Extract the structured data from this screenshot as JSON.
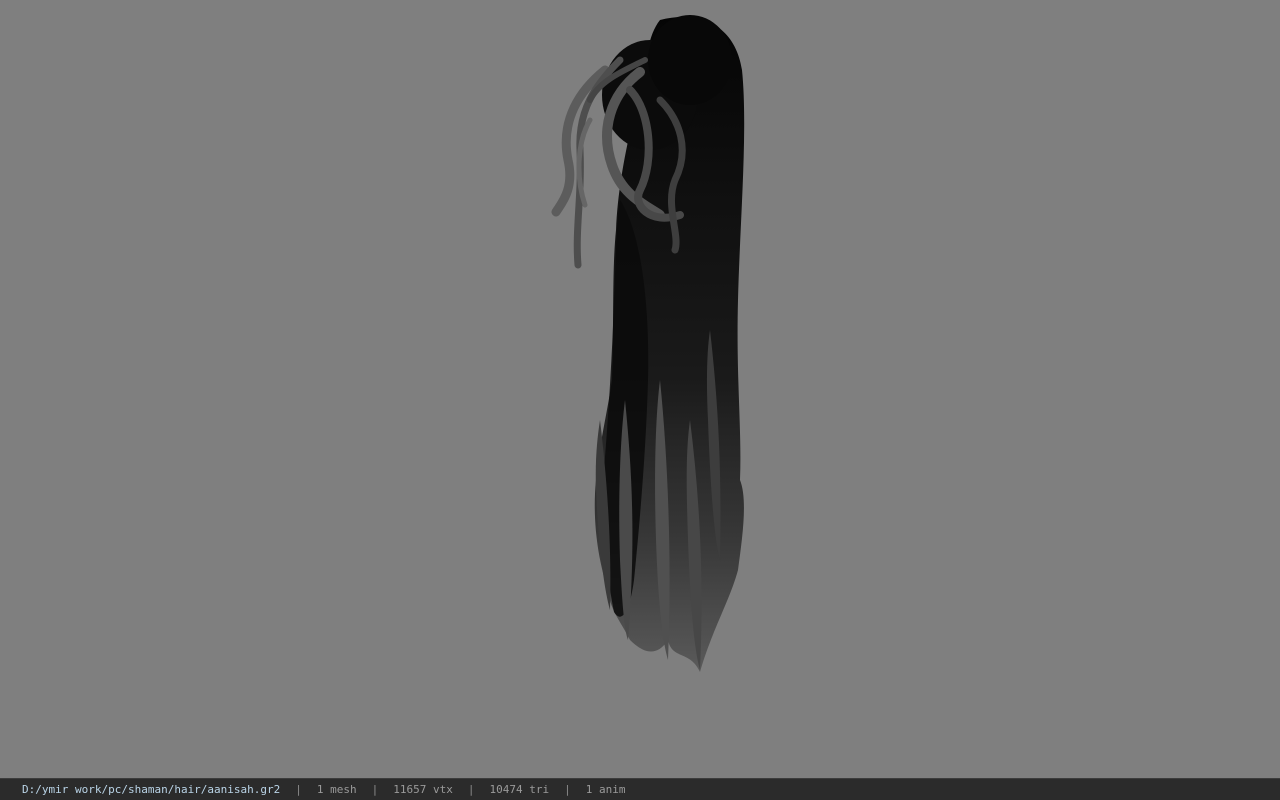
{
  "viewport": {
    "background": "#7f7f7f",
    "model_icon": "hair-model"
  },
  "status": {
    "file_path": "D:/ymir work/pc/shaman/hair/aanisah.gr2",
    "separator": "|",
    "mesh_count": "1 mesh",
    "vertex_count": "11657 vtx",
    "triangle_count": "10474 tri",
    "anim_count": "1 anim"
  }
}
